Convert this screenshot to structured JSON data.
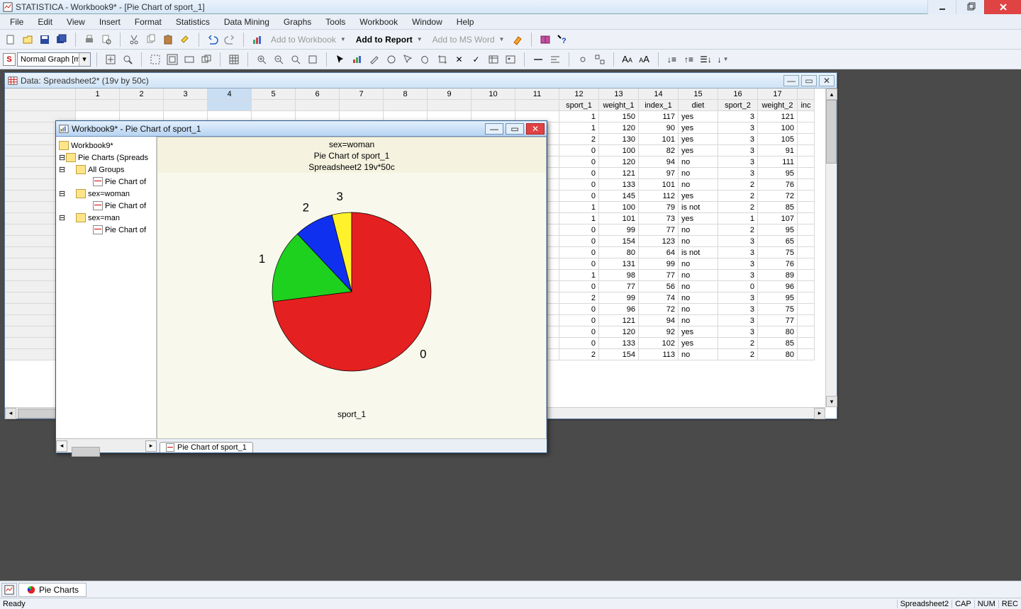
{
  "app_title": "STATISTICA - Workbook9* - [Pie Chart of sport_1]",
  "menu": [
    "File",
    "Edit",
    "View",
    "Insert",
    "Format",
    "Statistics",
    "Data Mining",
    "Graphs",
    "Tools",
    "Workbook",
    "Window",
    "Help"
  ],
  "toolbar1": {
    "add_to_workbook": "Add to Workbook",
    "add_to_report": "Add to Report",
    "add_to_msword": "Add to MS Word"
  },
  "toolbar2": {
    "type_combo_label": "S",
    "type_combo_value": "Normal Graph [m..."
  },
  "sheet_window_title": "Data: Spreadsheet2* (19v by 50c)",
  "workbook_window_title": "Workbook9* - Pie Chart of sport_1",
  "tree": {
    "root": "Workbook9*",
    "folder1": "Pie Charts (Spreads",
    "sub_all": "All Groups",
    "leaf": "Pie Chart of",
    "sub_women": "sex=woman",
    "sub_men": "sex=man"
  },
  "graph": {
    "title1": "sex=woman",
    "title2": "Pie Chart of sport_1",
    "title3": "Spreadsheet2 19v*50c",
    "xlabel": "sport_1",
    "tab_label": "Pie Chart of sport_1"
  },
  "chart_data": {
    "type": "pie",
    "title": "Pie Chart of sport_1",
    "subtitle": "sex=woman — Spreadsheet2 19v*50c",
    "xlabel": "sport_1",
    "categories": [
      "0",
      "1",
      "2",
      "3"
    ],
    "values": [
      73,
      15,
      8,
      4
    ],
    "colors": [
      "#e52020",
      "#1fd11f",
      "#1030f0",
      "#fff22a"
    ]
  },
  "sheet": {
    "col_numbers": [
      "1",
      "2",
      "3",
      "4",
      "5",
      "6",
      "7",
      "8",
      "9",
      "10",
      "11",
      "12",
      "13",
      "14",
      "15",
      "16",
      "17"
    ],
    "col_labels_tail": {
      "12": "sport_1",
      "13": "weight_1",
      "14": "index_1",
      "15": "diet",
      "16": "sport_2",
      "17": "weight_2",
      "18": "inc"
    },
    "rows": [
      {
        "sport_1": 1,
        "weight_1": 150,
        "index_1": 117,
        "diet": "yes",
        "sport_2": 3,
        "weight_2": 121
      },
      {
        "sport_1": 1,
        "weight_1": 120,
        "index_1": 90,
        "diet": "yes",
        "sport_2": 3,
        "weight_2": 100
      },
      {
        "sport_1": 2,
        "weight_1": 130,
        "index_1": 101,
        "diet": "yes",
        "sport_2": 3,
        "weight_2": 105
      },
      {
        "sport_1": 0,
        "weight_1": 100,
        "index_1": 82,
        "diet": "yes",
        "sport_2": 3,
        "weight_2": 91
      },
      {
        "sport_1": 0,
        "weight_1": 120,
        "index_1": 94,
        "diet": "no",
        "sport_2": 3,
        "weight_2": 111
      },
      {
        "sport_1": 0,
        "weight_1": 121,
        "index_1": 97,
        "diet": "no",
        "sport_2": 3,
        "weight_2": 95
      },
      {
        "sport_1": 0,
        "weight_1": 133,
        "index_1": 101,
        "diet": "no",
        "sport_2": 2,
        "weight_2": 76
      },
      {
        "sport_1": 0,
        "weight_1": 145,
        "index_1": 112,
        "diet": "yes",
        "sport_2": 2,
        "weight_2": 72
      },
      {
        "sport_1": 1,
        "weight_1": 100,
        "index_1": 79,
        "diet": "is not",
        "sport_2": 2,
        "weight_2": 85
      },
      {
        "sport_1": 1,
        "weight_1": 101,
        "index_1": 73,
        "diet": "yes",
        "sport_2": 1,
        "weight_2": 107
      },
      {
        "sport_1": 0,
        "weight_1": 99,
        "index_1": 77,
        "diet": "no",
        "sport_2": 2,
        "weight_2": 95
      },
      {
        "sport_1": 0,
        "weight_1": 154,
        "index_1": 123,
        "diet": "no",
        "sport_2": 3,
        "weight_2": 65
      },
      {
        "sport_1": 0,
        "weight_1": 80,
        "index_1": 64,
        "diet": "is not",
        "sport_2": 3,
        "weight_2": 75
      },
      {
        "sport_1": 0,
        "weight_1": 131,
        "index_1": 99,
        "diet": "no",
        "sport_2": 3,
        "weight_2": 76
      },
      {
        "sport_1": 1,
        "weight_1": 98,
        "index_1": 77,
        "diet": "no",
        "sport_2": 3,
        "weight_2": 89
      },
      {
        "sport_1": 0,
        "weight_1": 77,
        "index_1": 56,
        "diet": "no",
        "sport_2": 0,
        "weight_2": 96
      },
      {
        "sport_1": 2,
        "weight_1": 99,
        "index_1": 74,
        "diet": "no",
        "sport_2": 3,
        "weight_2": 95
      },
      {
        "sport_1": 0,
        "weight_1": 96,
        "index_1": 72,
        "diet": "no",
        "sport_2": 3,
        "weight_2": 75
      },
      {
        "sport_1": 0,
        "weight_1": 121,
        "index_1": 94,
        "diet": "no",
        "sport_2": 3,
        "weight_2": 77
      },
      {
        "sport_1": 0,
        "weight_1": 120,
        "index_1": 92,
        "diet": "yes",
        "sport_2": 3,
        "weight_2": 80
      },
      {
        "sport_1": 0,
        "weight_1": 133,
        "index_1": 102,
        "diet": "yes",
        "sport_2": 2,
        "weight_2": 85
      },
      {
        "sport_1": 2,
        "weight_1": 154,
        "index_1": 113,
        "diet": "no",
        "sport_2": 2,
        "weight_2": 80
      }
    ]
  },
  "taskbar": {
    "pie_charts": "Pie Charts"
  },
  "status": {
    "ready": "Ready",
    "sheet": "Spreadsheet2",
    "cap": "CAP",
    "num": "NUM",
    "rec": "REC"
  }
}
